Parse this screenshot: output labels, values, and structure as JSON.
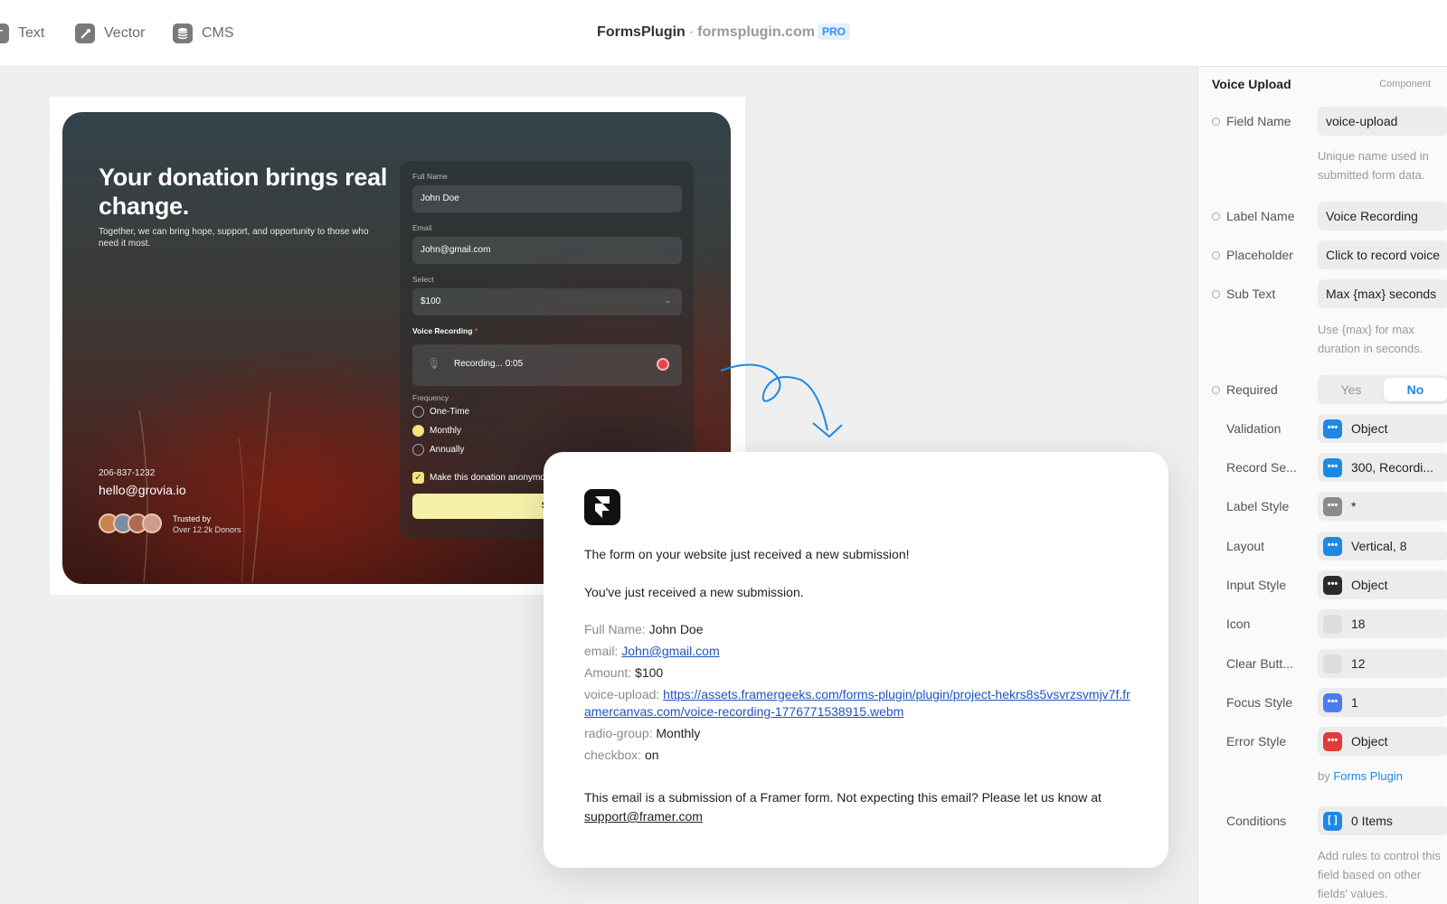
{
  "toolbar": {
    "tools": [
      {
        "label": "Text",
        "icon": "text-icon"
      },
      {
        "label": "Vector",
        "icon": "vector-pen-icon"
      },
      {
        "label": "CMS",
        "icon": "database-icon"
      }
    ],
    "brand_name": "FormsPlugin",
    "brand_sep": "·",
    "brand_domain": "formsplugin.com",
    "brand_badge": "PRO"
  },
  "donation_card": {
    "title": "Your donation brings real change.",
    "subtitle": "Together, we can bring hope, support, and opportunity to those who need it most.",
    "phone": "206-837-1232",
    "email": "hello@grovia.io",
    "trusted_by": "Trusted by",
    "donors": "Over 12.2k Donors",
    "form": {
      "full_name_label": "Full Name",
      "full_name_value": "John Doe",
      "email_label": "Email",
      "email_value": "John@gmail.com",
      "select_label": "Select",
      "select_value": "$100",
      "voice_label": "Voice Recording",
      "voice_required": "*",
      "recording_text": "Recording... 0:05",
      "frequency_label": "Frequency",
      "frequency_options": [
        "One-Time",
        "Monthly",
        "Annually"
      ],
      "frequency_selected": "Monthly",
      "anonymous_label": "Make this donation anonymo",
      "submit_label": "Su"
    }
  },
  "email_preview": {
    "line1": "The form on your website just received a new submission!",
    "line2": "You've just received a new submission.",
    "fields": [
      {
        "key": "Full Name:",
        "value": "John Doe",
        "link": false
      },
      {
        "key": "email:",
        "value": "John@gmail.com",
        "link": true
      },
      {
        "key": "Amount:",
        "value": "$100",
        "link": false
      },
      {
        "key": "voice-upload:",
        "value": "https://assets.framergeeks.com/forms-plugin/plugin/project-hekrs8s5vsvrzsvmjv7f.framercanvas.com/voice-recording-1776771538915.webm",
        "link": true
      },
      {
        "key": "radio-group:",
        "value": "Monthly",
        "link": false
      },
      {
        "key": "checkbox:",
        "value": "on",
        "link": false
      }
    ],
    "footer": "This email is a submission of a Framer form. Not expecting this email? Please let us know at",
    "footer_link": "support@framer.com"
  },
  "panel": {
    "title": "Voice Upload",
    "tag": "Component",
    "field_name_label": "Field Name",
    "field_name_value": "voice-upload",
    "field_name_hint": "Unique name used in submitted form data.",
    "label_name_label": "Label Name",
    "label_name_value": "Voice Recording",
    "placeholder_label": "Placeholder",
    "placeholder_value": "Click to record voice",
    "subtext_label": "Sub Text",
    "subtext_value": "Max {max} seconds",
    "subtext_hint": "Use {max} for max duration in seconds.",
    "required_label": "Required",
    "required_yes": "Yes",
    "required_no": "No",
    "props": [
      {
        "label": "Validation",
        "value": "Object",
        "color": "#1e88e5"
      },
      {
        "label": "Record Se...",
        "value": "300, Recordi...",
        "color": "#1e88e5"
      },
      {
        "label": "Label Style",
        "value": "*",
        "color": "#8a8a8a"
      },
      {
        "label": "Layout",
        "value": "Vertical, 8",
        "color": "#1e88e5"
      },
      {
        "label": "Input Style",
        "value": "Object",
        "color": "#2b2b2b"
      },
      {
        "label": "Icon",
        "value": "18",
        "color": "#dddddd"
      },
      {
        "label": "Clear Butt...",
        "value": "12",
        "color": "#dddddd"
      },
      {
        "label": "Focus Style",
        "value": "1",
        "color": "#4a7cf0"
      },
      {
        "label": "Error Style",
        "value": "Object",
        "color": "#e03a3a"
      }
    ],
    "by": "by",
    "by_link": "Forms Plugin",
    "conditions_label": "Conditions",
    "conditions_value": "0 Items",
    "conditions_hint": "Add rules to control this field based on other fields' values."
  }
}
